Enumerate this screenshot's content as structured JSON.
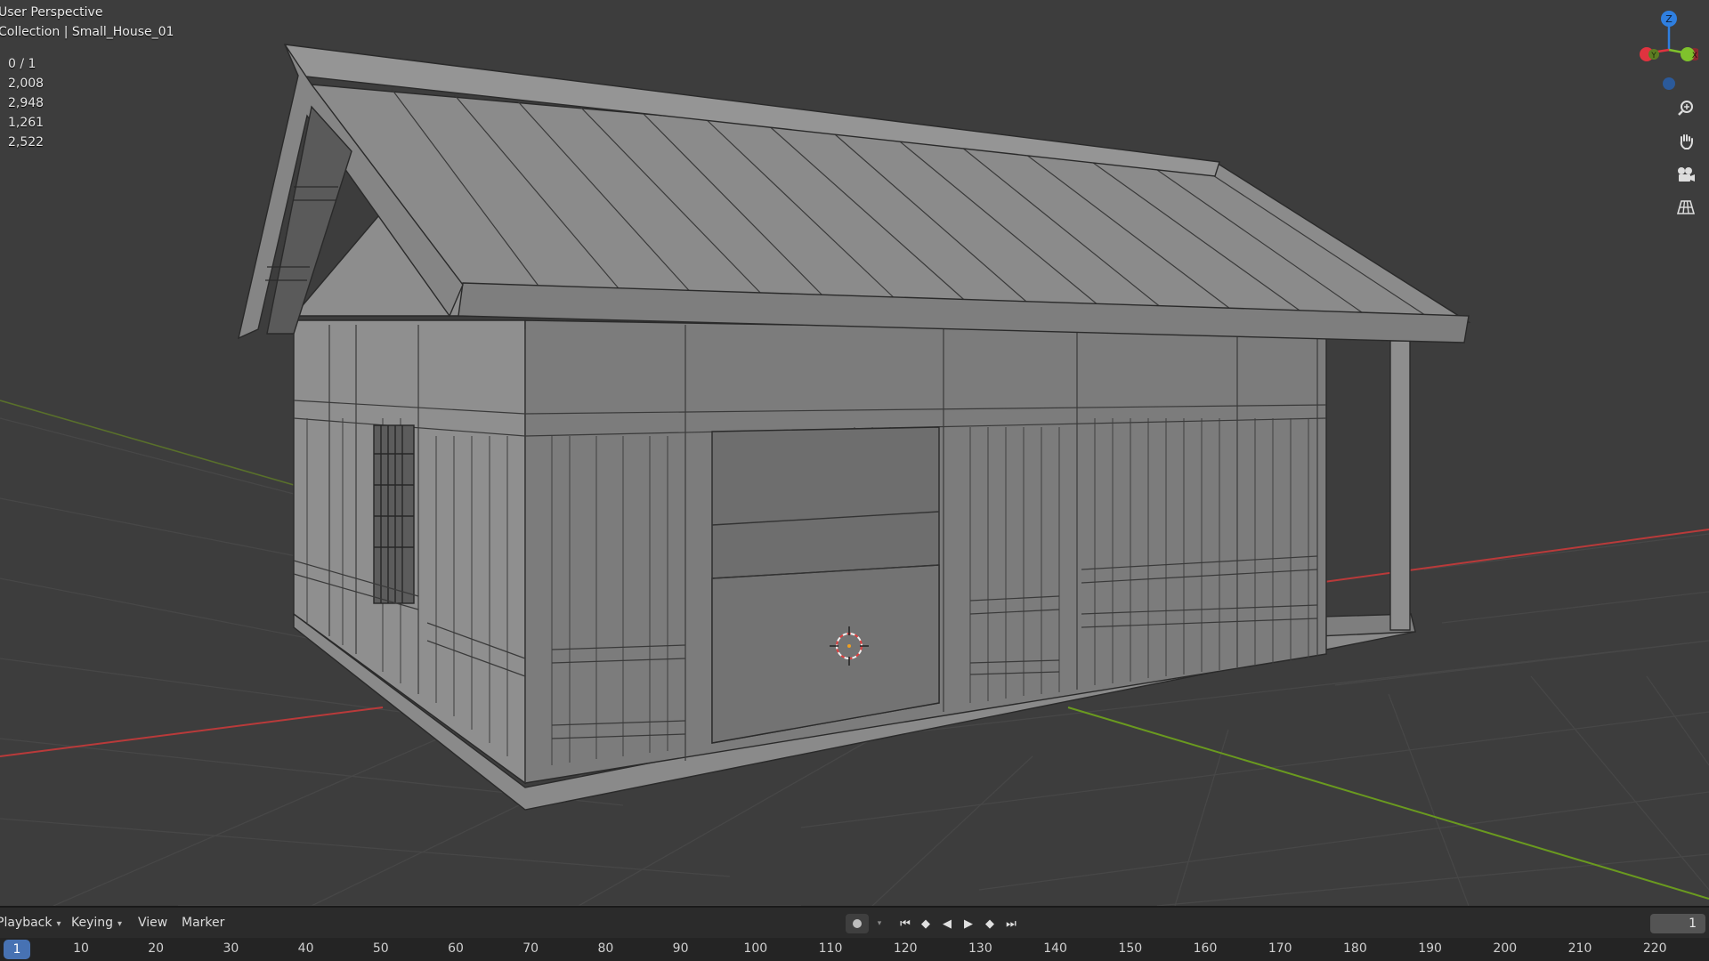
{
  "viewport": {
    "view_name": "User Perspective",
    "collection_label": "Collection | Small_House_01",
    "stats": [
      "0 / 1",
      "2,008",
      "2,948",
      "1,261",
      "2,522"
    ]
  },
  "gizmo": {
    "axes": [
      {
        "label": "Z",
        "color": "#2f7fe0"
      },
      {
        "label": "Y",
        "color": "#7fc22c"
      },
      {
        "label": "X",
        "color": "#e0333f"
      }
    ]
  },
  "nav_tools": [
    "zoom-icon",
    "hand-pan-icon",
    "camera-icon",
    "grid-perspective-icon"
  ],
  "timeline": {
    "menus": [
      {
        "label": "Playback",
        "dropdown": true
      },
      {
        "label": "Keying",
        "dropdown": true
      },
      {
        "label": "View",
        "dropdown": false
      },
      {
        "label": "Marker",
        "dropdown": false
      }
    ],
    "transport_icons": {
      "jump_start": "⏮",
      "prev_key": "◆",
      "play_reverse": "◀",
      "play": "▶",
      "next_key": "◆",
      "jump_end": "⏭"
    },
    "current_frame": "1",
    "current_frame_marker": "1",
    "ruler_ticks": [
      "10",
      "20",
      "30",
      "40",
      "50",
      "60",
      "70",
      "80",
      "90",
      "100",
      "110",
      "120",
      "130",
      "140",
      "150",
      "160",
      "170",
      "180",
      "190",
      "200",
      "210",
      "220"
    ]
  },
  "colors": {
    "viewport_bg": "#3d3d3d",
    "accent_blue": "#4772b3",
    "axis_x": "#b93a3a",
    "axis_y": "#6a9a1f"
  }
}
